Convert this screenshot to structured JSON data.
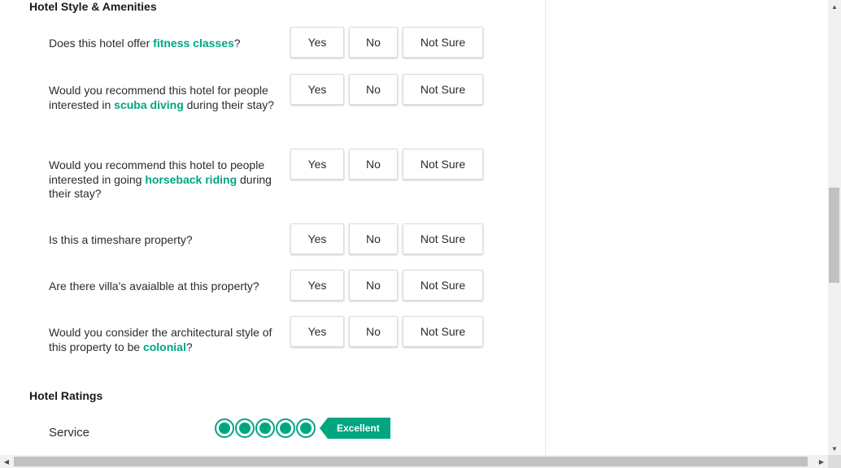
{
  "sections": {
    "amenities_title": "Hotel Style & Amenities",
    "ratings_title": "Hotel Ratings"
  },
  "buttons": {
    "yes": "Yes",
    "no": "No",
    "not_sure": "Not Sure"
  },
  "questions": [
    {
      "pre": "Does this hotel offer ",
      "highlight": "fitness classes",
      "post": "?"
    },
    {
      "pre": "Would you recommend this hotel for people interested in ",
      "highlight": "scuba diving",
      "post": " during their stay?"
    },
    {
      "pre": "Would you recommend this hotel to people interested in going ",
      "highlight": "horseback riding",
      "post": " during their stay?"
    },
    {
      "pre": "Is this a timeshare property?",
      "highlight": "",
      "post": ""
    },
    {
      "pre": "Are there villa's avaialble at this property?",
      "highlight": "",
      "post": ""
    },
    {
      "pre": "Would you consider the architectural style of this property to be ",
      "highlight": "colonial",
      "post": "?"
    }
  ],
  "ratings": [
    {
      "label": "Service",
      "score": 5,
      "max": 5,
      "badge": "Excellent"
    }
  ],
  "colors": {
    "accent": "#00a680",
    "text": "#2c2c2c"
  }
}
